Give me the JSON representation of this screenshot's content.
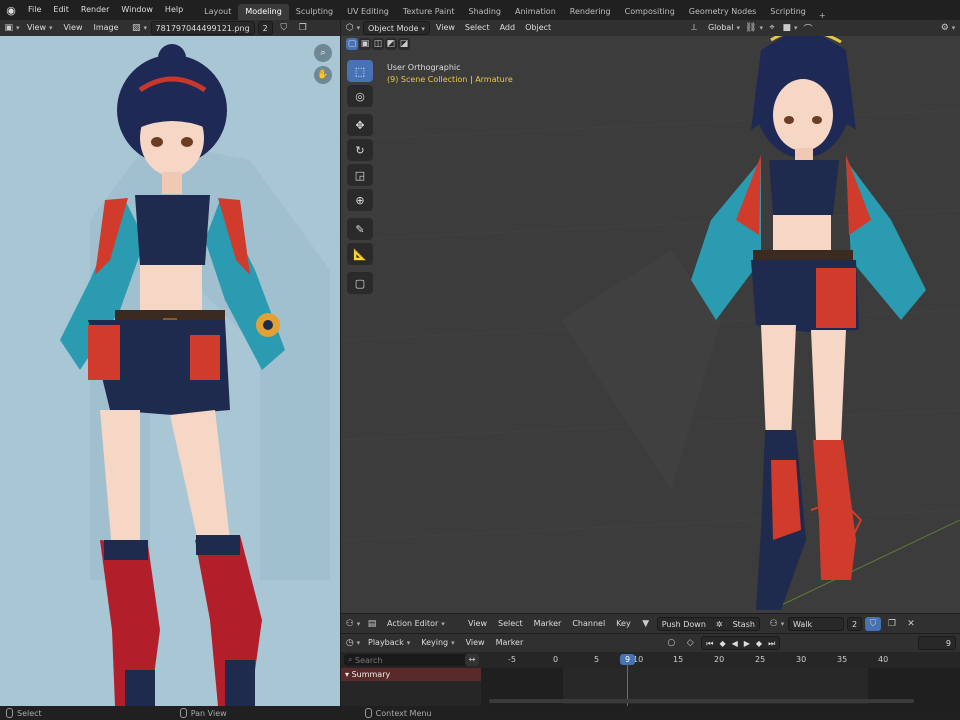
{
  "menu": [
    "File",
    "Edit",
    "Render",
    "Window",
    "Help"
  ],
  "workspaces": [
    "Layout",
    "Modeling",
    "Sculpting",
    "UV Editing",
    "Texture Paint",
    "Shading",
    "Animation",
    "Rendering",
    "Compositing",
    "Geometry Nodes",
    "Scripting"
  ],
  "active_workspace": "Modeling",
  "image_editor": {
    "view": "View",
    "menus": [
      "View",
      "Image"
    ],
    "image_name": "781797044499121.png",
    "users": "2"
  },
  "viewport": {
    "mode": "Object Mode",
    "menus": [
      "View",
      "Select",
      "Add",
      "Object"
    ],
    "transform": "Global",
    "view_name": "User Orthographic",
    "collection": "(9) Scene Collection",
    "object": "Armature"
  },
  "action_editor": {
    "mode": "Action Editor",
    "menus": [
      "View",
      "Select",
      "Marker",
      "Channel",
      "Key"
    ],
    "push_down": "Push Down",
    "stash": "Stash",
    "action": "Walk",
    "users": "2"
  },
  "timeline": {
    "menus": [
      "Playback",
      "Keying",
      "View",
      "Marker"
    ],
    "current_frame": "9",
    "frame_field": "9",
    "ruler": [
      "-5",
      "0",
      "5",
      "10",
      "15",
      "20",
      "25",
      "30",
      "35",
      "40"
    ],
    "search_placeholder": "Search",
    "summary": "Summary"
  },
  "status": [
    "Select",
    "Pan View",
    "Context Menu"
  ],
  "colors": {
    "accent": "#4772b3",
    "highlight": "#e8c84a",
    "summary": "#5a2a2a",
    "playhead": "#4772b3"
  }
}
